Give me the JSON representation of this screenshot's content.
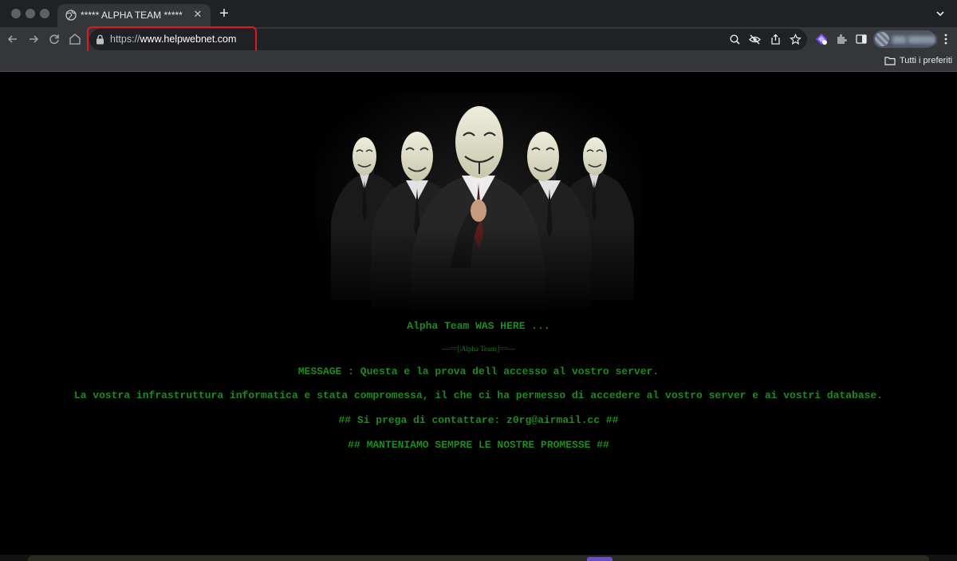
{
  "browser": {
    "tab_title": "***** ALPHA TEAM *****",
    "tab_close": "✕",
    "new_tab": "+",
    "url_scheme": "https://",
    "url_host": "www.helpwebnet.com",
    "bookmarks_folder": "Tutti i preferiti",
    "icons": {
      "back": "back-arrow-icon",
      "forward": "forward-arrow-icon",
      "reload": "reload-icon",
      "home": "home-icon",
      "lock": "lock-icon",
      "zoom": "zoom-icon",
      "tracking": "eye-off-icon",
      "share": "share-icon",
      "bookmark": "star-icon",
      "extension1": "extension-icon",
      "extensions": "puzzle-icon",
      "sidepanel": "side-panel-icon",
      "menu": "kebab-menu-icon",
      "tab_search": "chevron-down-icon"
    },
    "accent_highlight": "#e0181c"
  },
  "page": {
    "headline": "Alpha Team WAS HERE ...",
    "signature": "---==[|Alpha Team|]==---",
    "message": "MESSAGE : Questa e la prova dell accesso al vostro server.",
    "infrastructure": "La vostra infrastruttura informatica e stata compromessa, il che ci ha permesso di accedere al vostro server e ai vostri database.",
    "contact": "## Si prega di contattare: z0rg@airmail.cc ##",
    "promise": "## MANTENIAMO SEMPRE LE NOSTRE PROMESSE ##",
    "text_color": "#1f8a1f",
    "background_color": "#000000"
  }
}
